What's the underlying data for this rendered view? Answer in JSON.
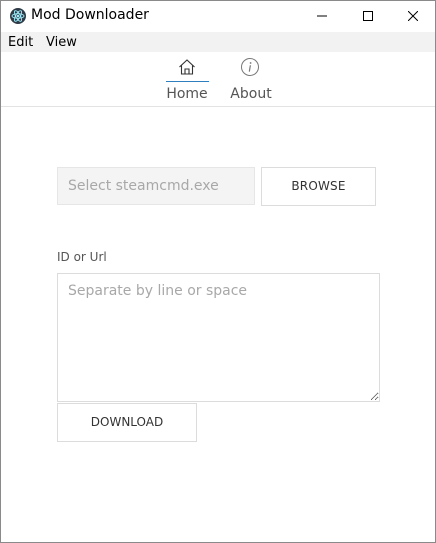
{
  "window": {
    "title": "Mod Downloader",
    "icons": {
      "app": "electron-app-icon",
      "minimize": "minimize-icon",
      "maximize": "maximize-icon",
      "close": "close-icon"
    }
  },
  "menu": {
    "items": [
      {
        "label": "Edit"
      },
      {
        "label": "View"
      }
    ]
  },
  "nav": {
    "tabs": [
      {
        "label": "Home",
        "icon": "home-icon",
        "active": true
      },
      {
        "label": "About",
        "icon": "info-icon",
        "active": false
      }
    ],
    "accent": "#2f7fbf"
  },
  "main": {
    "steamcmd": {
      "placeholder": "Select steamcmd.exe",
      "value": ""
    },
    "browse_label": "BROWSE",
    "ids": {
      "label": "ID or Url",
      "placeholder": "Separate by line or space",
      "value": ""
    },
    "download_label": "DOWNLOAD"
  }
}
